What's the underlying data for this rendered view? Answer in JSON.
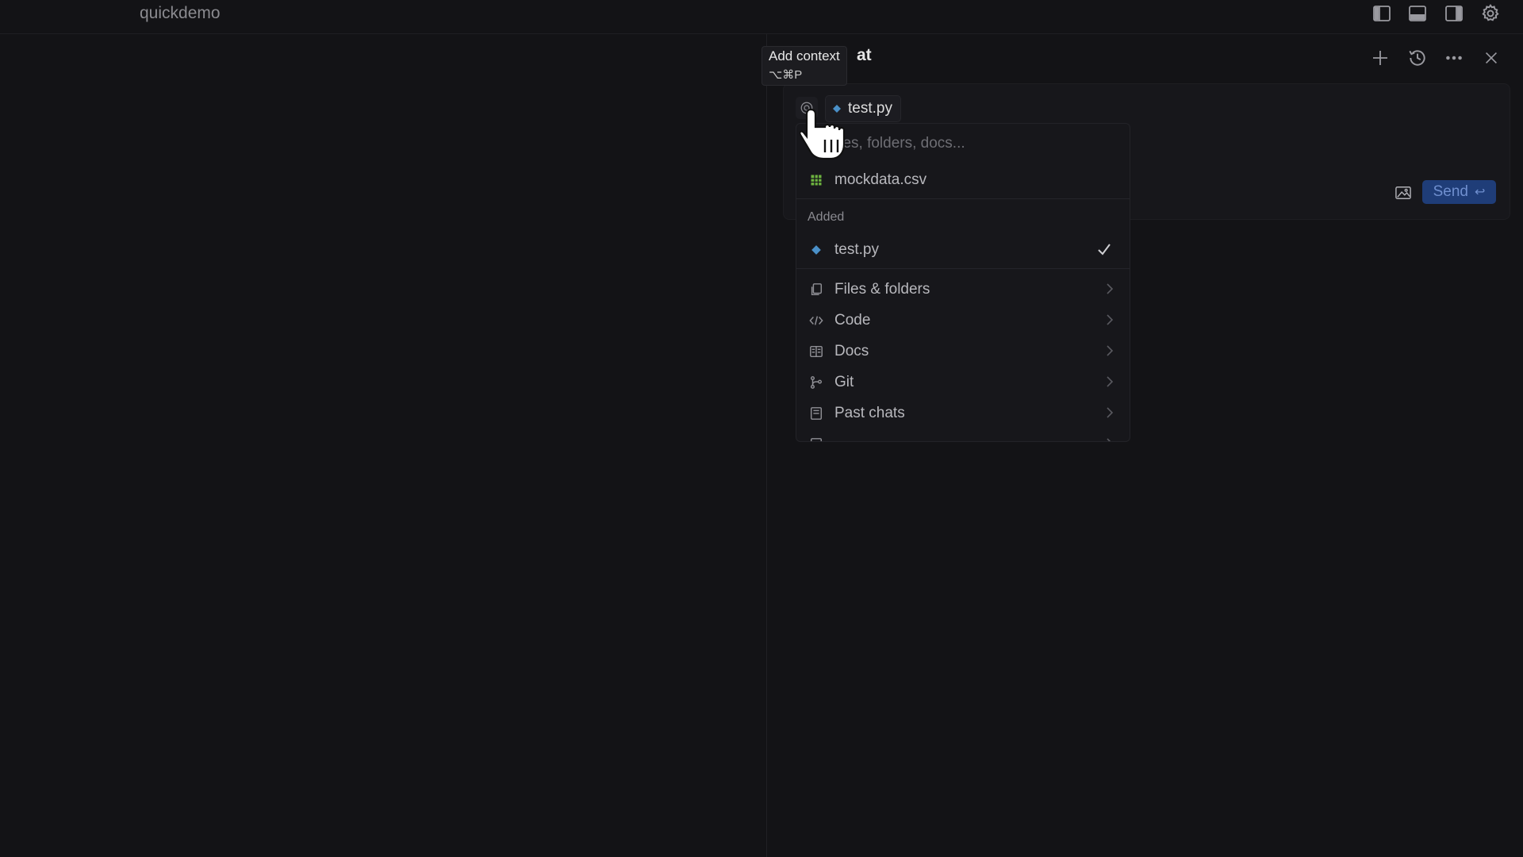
{
  "window": {
    "title": "quickdemo"
  },
  "titlebar_icons": [
    "toggle-primary-sidebar-icon",
    "toggle-panel-icon",
    "toggle-secondary-sidebar-icon",
    "settings-gear-icon"
  ],
  "chat": {
    "title": "at",
    "header_icons": [
      "plus-icon",
      "history-icon",
      "more-icon",
      "close-icon"
    ],
    "context_chip": {
      "label": "test.py",
      "icon": "python-file-icon"
    },
    "send_label": "Send",
    "send_shortcut": "↩"
  },
  "tooltip": {
    "label": "Add context",
    "shortcut": "⌥⌘P"
  },
  "dropdown": {
    "search_placeholder": "iles, folders, docs...",
    "suggestion": {
      "label": "mockdata.csv",
      "icon": "csv-file-icon"
    },
    "added_header": "Added",
    "added_item": {
      "label": "test.py",
      "icon": "python-file-icon"
    },
    "categories": [
      {
        "label": "Files & folders",
        "icon": "files-icon"
      },
      {
        "label": "Code",
        "icon": "code-icon"
      },
      {
        "label": "Docs",
        "icon": "docs-icon"
      },
      {
        "label": "Git",
        "icon": "git-icon"
      },
      {
        "label": "Past chats",
        "icon": "past-chats-icon"
      }
    ]
  },
  "colors": {
    "background": "#131316",
    "panel": "#17171b",
    "send_button": "#1f3d78",
    "python_icon": "#4a90c8",
    "csv_icon": "#6db33f"
  }
}
